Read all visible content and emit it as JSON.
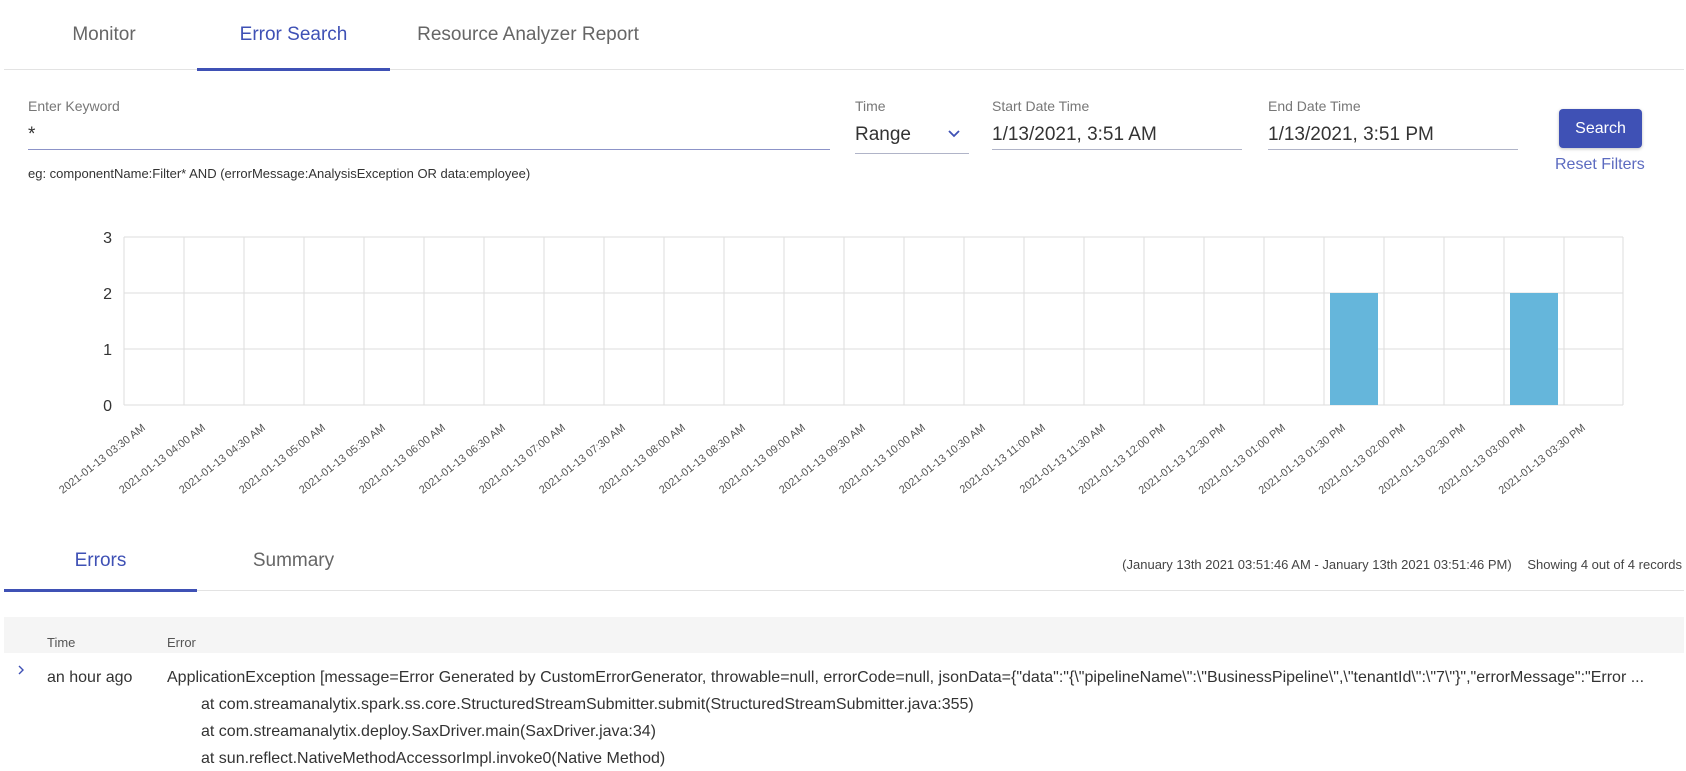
{
  "top_tabs": [
    {
      "label": "Monitor",
      "active": false
    },
    {
      "label": "Error Search",
      "active": true
    },
    {
      "label": "Resource Analyzer Report",
      "active": false
    }
  ],
  "filters": {
    "keyword_label": "Enter Keyword",
    "keyword_value": "*",
    "time_label": "Time",
    "time_value": "Range",
    "start_label": "Start Date Time",
    "start_value": "1/13/2021, 3:51 AM",
    "end_label": "End Date Time",
    "end_value": "1/13/2021, 3:51 PM",
    "search_label": "Search",
    "reset_label": "Reset Filters",
    "hint": "eg: componentName:Filter* AND (errorMessage:AnalysisException OR data:employee)"
  },
  "chart_data": {
    "type": "bar",
    "categories": [
      "2021-01-13 03:30 AM",
      "2021-01-13 04:00 AM",
      "2021-01-13 04:30 AM",
      "2021-01-13 05:00 AM",
      "2021-01-13 05:30 AM",
      "2021-01-13 06:00 AM",
      "2021-01-13 06:30 AM",
      "2021-01-13 07:00 AM",
      "2021-01-13 07:30 AM",
      "2021-01-13 08:00 AM",
      "2021-01-13 08:30 AM",
      "2021-01-13 09:00 AM",
      "2021-01-13 09:30 AM",
      "2021-01-13 10:00 AM",
      "2021-01-13 10:30 AM",
      "2021-01-13 11:00 AM",
      "2021-01-13 11:30 AM",
      "2021-01-13 12:00 PM",
      "2021-01-13 12:30 PM",
      "2021-01-13 01:00 PM",
      "2021-01-13 01:30 PM",
      "2021-01-13 02:00 PM",
      "2021-01-13 02:30 PM",
      "2021-01-13 03:00 PM",
      "2021-01-13 03:30 PM"
    ],
    "values": [
      0,
      0,
      0,
      0,
      0,
      0,
      0,
      0,
      0,
      0,
      0,
      0,
      0,
      0,
      0,
      0,
      0,
      0,
      0,
      0,
      2,
      0,
      0,
      2,
      0
    ],
    "ylim": [
      0,
      3
    ],
    "yticks": [
      0,
      1,
      2,
      3
    ],
    "grid": true,
    "bar_color": "#65b6db",
    "title": "",
    "xlabel": "",
    "ylabel": ""
  },
  "sub_tabs": [
    {
      "label": "Errors",
      "active": true
    },
    {
      "label": "Summary",
      "active": false
    }
  ],
  "range_text": "(January 13th 2021 03:51:46 AM - January 13th 2021 03:51:46 PM)",
  "records_text": "Showing 4 out of 4 records",
  "table": {
    "columns": [
      "Time",
      "Error"
    ],
    "rows": [
      {
        "time": "an hour ago",
        "error_main": "ApplicationException [message=Error Generated by CustomErrorGenerator, throwable=null, errorCode=null, jsonData={\"data\":\"{\\\"pipelineName\\\":\\\"BusinessPipeline\\\",\\\"tenantId\\\":\\\"7\\\"}\",\"errorMessage\":\"Error ...",
        "stack": [
          "at com.streamanalytix.spark.ss.core.StructuredStreamSubmitter.submit(StructuredStreamSubmitter.java:355)",
          "at com.streamanalytix.deploy.SaxDriver.main(SaxDriver.java:34)",
          "at sun.reflect.NativeMethodAccessorImpl.invoke0(Native Method)"
        ]
      }
    ]
  },
  "colors": {
    "accent": "#3f51b5",
    "bar": "#65b6db"
  }
}
